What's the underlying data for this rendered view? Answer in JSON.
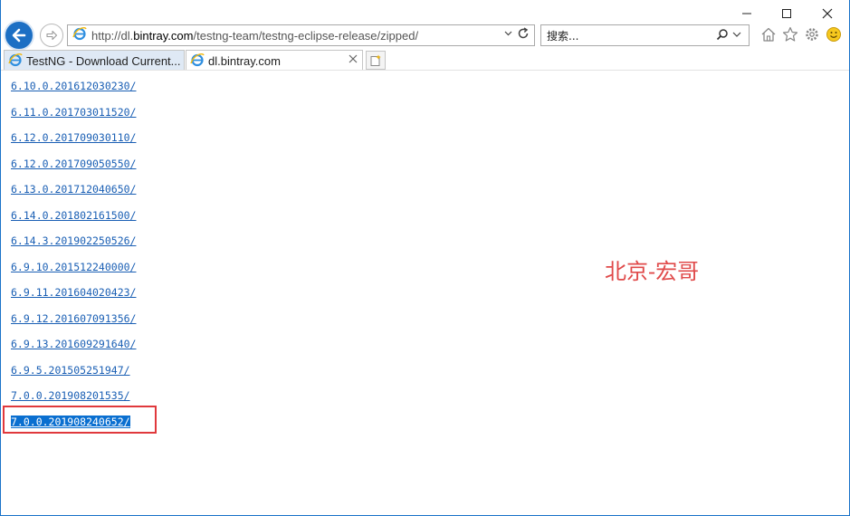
{
  "browser": {
    "address": {
      "prefix": "http://dl.",
      "host": "bintray.com",
      "path": "/testng-team/testng-eclipse-release/zipped/"
    },
    "search_placeholder": "搜索...",
    "tabs": [
      {
        "label": "TestNG - Download Current..."
      },
      {
        "label": "dl.bintray.com"
      }
    ]
  },
  "listing": [
    {
      "name": "6.10.0.201612030230/"
    },
    {
      "name": "6.11.0.201703011520/"
    },
    {
      "name": "6.12.0.201709030110/"
    },
    {
      "name": "6.12.0.201709050550/"
    },
    {
      "name": "6.13.0.201712040650/"
    },
    {
      "name": "6.14.0.201802161500/"
    },
    {
      "name": "6.14.3.201902250526/"
    },
    {
      "name": "6.9.10.201512240000/"
    },
    {
      "name": "6.9.11.201604020423/"
    },
    {
      "name": "6.9.12.201607091356/"
    },
    {
      "name": "6.9.13.201609291640/"
    },
    {
      "name": "6.9.5.201505251947/"
    },
    {
      "name": "7.0.0.201908201535/"
    },
    {
      "name": "7.0.0.201908240652/",
      "selected": true
    }
  ],
  "watermark": "北京-宏哥",
  "colors": {
    "link": "#1a5fb4",
    "selection": "#0a6fd0",
    "highlight_box": "#e0393c",
    "watermark": "#e04a4a"
  }
}
